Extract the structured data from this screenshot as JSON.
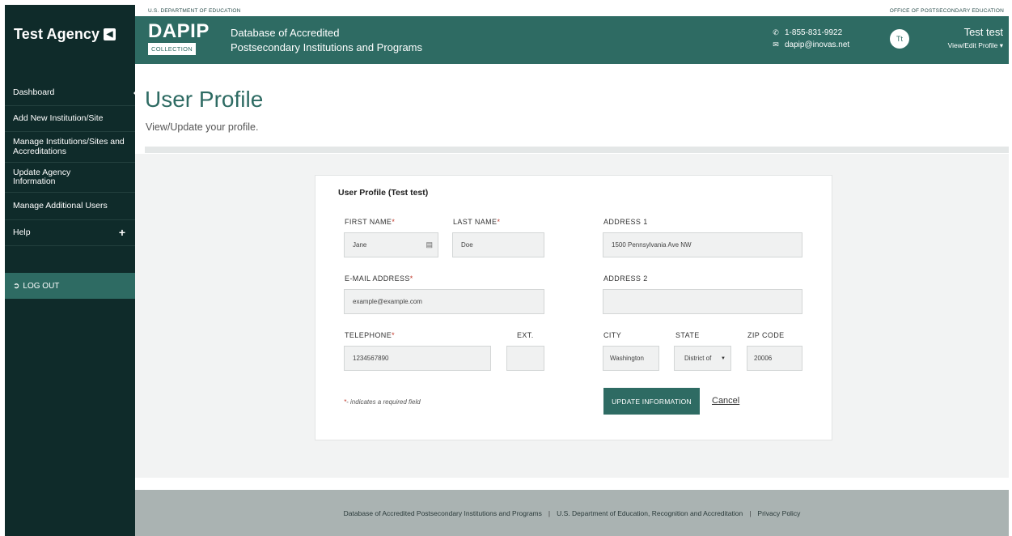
{
  "sidebar": {
    "brand": "Test Agency",
    "collapse_icon": "chevron-left-icon",
    "items": [
      {
        "label": "Dashboard"
      },
      {
        "label": "Add New Institution/Site"
      },
      {
        "label": "Manage Institutions/Sites and Accreditations"
      },
      {
        "label": "Update Agency Information"
      },
      {
        "label": "Manage Additional Users"
      },
      {
        "label": "Help"
      }
    ],
    "help_expand": "+",
    "logout": "LOG OUT"
  },
  "topstrip": {
    "left": "U.S. DEPARTMENT OF EDUCATION",
    "right": "OFFICE OF POSTSECONDARY EDUCATION"
  },
  "header": {
    "logo_main": "DAPIP",
    "logo_sub": "COLLECTION",
    "title_line1": "Database of Accredited",
    "title_line2": "Postsecondary Institutions and Programs",
    "phone": "1-855-831-9922",
    "email": "dapip@inovas.net",
    "avatar_initials": "Tt",
    "user_name": "Test test",
    "profile_link": "View/Edit Profile ▾"
  },
  "page": {
    "title": "User Profile",
    "subtitle": "View/Update your profile."
  },
  "form": {
    "title": "User Profile (Test test)",
    "first_name": {
      "label": "FIRST NAME",
      "value": "Jane"
    },
    "last_name": {
      "label": "LAST NAME",
      "value": "Doe"
    },
    "email": {
      "label": "E-MAIL ADDRESS",
      "value": "example@example.com"
    },
    "telephone": {
      "label": "TELEPHONE",
      "value": "1234567890"
    },
    "ext": {
      "label": "EXT.",
      "value": ""
    },
    "address1": {
      "label": "ADDRESS 1",
      "value": "1500 Pennsylvania Ave NW"
    },
    "address2": {
      "label": "ADDRESS 2",
      "value": ""
    },
    "city": {
      "label": "CITY",
      "value": "Washington"
    },
    "state": {
      "label": "STATE",
      "value": "District of"
    },
    "zip": {
      "label": "ZIP CODE",
      "value": "20006"
    },
    "required_mark": "*",
    "required_note": "- indicates a required field",
    "update_button": "UPDATE INFORMATION",
    "cancel_link": "Cancel"
  },
  "footer": {
    "links": [
      "Database of Accredited Postsecondary Institutions and Programs",
      "U.S. Department of Education, Recognition and Accreditation",
      "Privacy Policy"
    ],
    "separator": "|"
  },
  "colors": {
    "sidebar_bg": "#0f2b2a",
    "brand_teal": "#2e6b63",
    "footer_bg": "#aab3b2",
    "required_red": "#c0392b"
  }
}
